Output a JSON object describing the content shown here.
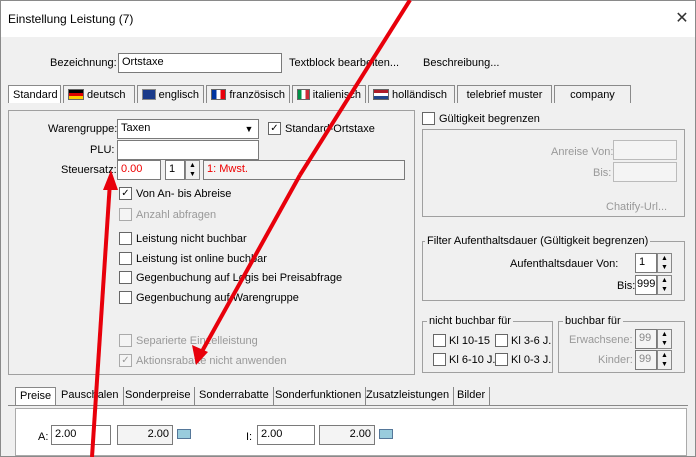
{
  "window": {
    "title": "Einstellung Leistung (7)",
    "close": "✕"
  },
  "top": {
    "bezeichnung_label": "Bezeichnung:",
    "bezeichnung_value": "Ortstaxe",
    "textblock_link": "Textblock bearbeiten...",
    "beschreibung_link": "Beschreibung..."
  },
  "lang_tabs": [
    {
      "label": "Standard"
    },
    {
      "label": "deutsch"
    },
    {
      "label": "englisch"
    },
    {
      "label": "französisch"
    },
    {
      "label": "italienisch"
    },
    {
      "label": "holländisch"
    },
    {
      "label": "telebrief muster"
    },
    {
      "label": "company"
    }
  ],
  "left": {
    "warengruppe_label": "Warengruppe:",
    "warengruppe_value": "Taxen",
    "standard_ortstaxe": "Standard-Ortstaxe",
    "plu_label": "PLU:",
    "plu_value": "",
    "steuersatz_label": "Steuersatz:",
    "steuer_value": "0.00",
    "steuer_code": "1",
    "steuer_desc": "1: Mwst.",
    "checks": [
      {
        "label": "Von An- bis Abreise",
        "checked": true,
        "disabled": false
      },
      {
        "label": "Anzahl abfragen",
        "checked": false,
        "disabled": true
      },
      {
        "label": "Leistung nicht buchbar",
        "checked": false,
        "disabled": false
      },
      {
        "label": "Leistung ist online buchbar",
        "checked": false,
        "disabled": false
      },
      {
        "label": "Gegenbuchung auf Logis bei Preisabfrage",
        "checked": false,
        "disabled": false
      },
      {
        "label": "Gegenbuchung auf Warengruppe",
        "checked": false,
        "disabled": false
      },
      {
        "label": "Separierte Einzelleistung",
        "checked": false,
        "disabled": true
      },
      {
        "label": "Aktionsrabatte nicht anwenden",
        "checked": true,
        "disabled": true
      }
    ]
  },
  "right": {
    "gueltigkeit": "Gültigkeit begrenzen",
    "anreise_von": "Anreise Von:",
    "bis": "Bis:",
    "chatify": "Chatify-Url...",
    "filter_title": "Filter Aufenthaltsdauer (Gültigkeit begrenzen)",
    "aufenthalt_von": "Aufenthaltsdauer Von:",
    "aufenthalt_von_value": "1",
    "aufenthalt_bis": "Bis:",
    "aufenthalt_bis_value": "999",
    "nicht_buchbar_title": "nicht buchbar für",
    "kl": [
      "Kl 10-15",
      "Kl 3-6 J.",
      "Kl 6-10 J.",
      "Kl 0-3 J."
    ],
    "buchbar_title": "buchbar für",
    "erwachsene": "Erwachsene:",
    "erwachsene_value": "99",
    "kinder": "Kinder:",
    "kinder_value": "99"
  },
  "bottom_tabs": [
    {
      "label": "Preise"
    },
    {
      "label": "Pauschalen"
    },
    {
      "label": "Sonderpreise"
    },
    {
      "label": "Sonderrabatte"
    },
    {
      "label": "Sonderfunktionen"
    },
    {
      "label": "Zusatzleistungen"
    },
    {
      "label": "Bilder"
    }
  ],
  "prices": {
    "a_label": "A:",
    "a_value": "2.00",
    "a_display": "2.00",
    "i_label": "I:",
    "i_value": "2.00",
    "i_display": "2.00"
  }
}
